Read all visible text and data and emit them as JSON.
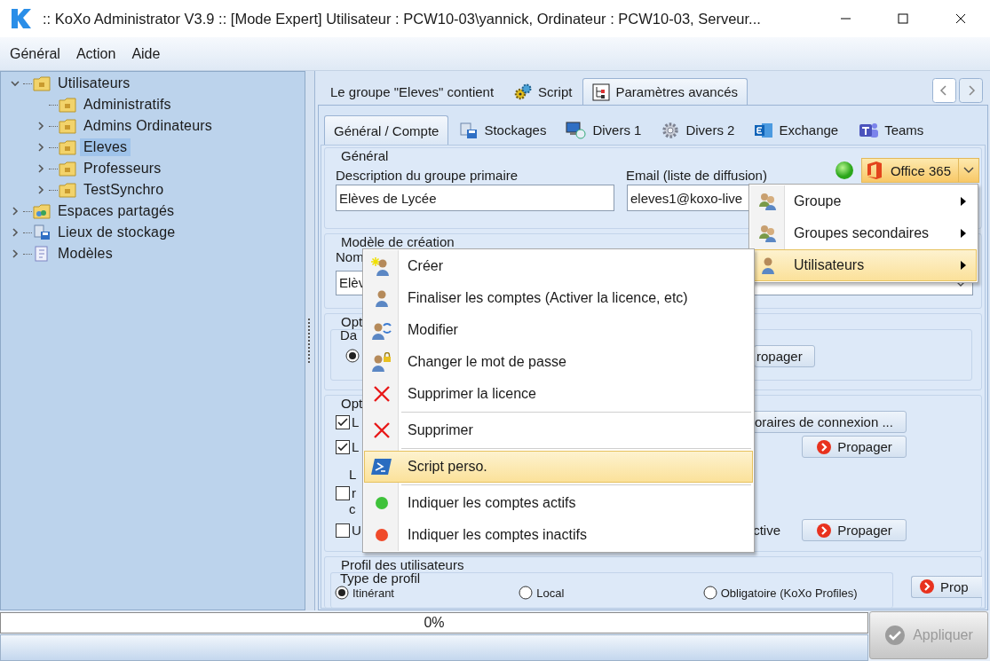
{
  "window": {
    "title": ":: KoXo Administrator V3.9 :: [Mode Expert] Utilisateur : PCW10-03\\yannick, Ordinateur : PCW10-03, Serveur..."
  },
  "menubar": [
    "Général",
    "Action",
    "Aide"
  ],
  "tree": [
    {
      "label": "Utilisateurs",
      "expandable": true,
      "expanded": true,
      "selected": false,
      "children": [
        {
          "label": "Administratifs",
          "expandable": false,
          "expanded": false,
          "selected": false
        },
        {
          "label": "Admins Ordinateurs",
          "expandable": true,
          "expanded": false,
          "selected": false
        },
        {
          "label": "Eleves",
          "expandable": true,
          "expanded": false,
          "selected": true
        },
        {
          "label": "Professeurs",
          "expandable": true,
          "expanded": false,
          "selected": false
        },
        {
          "label": "TestSynchro",
          "expandable": true,
          "expanded": false,
          "selected": false
        }
      ]
    },
    {
      "label": "Espaces partagés",
      "expandable": true,
      "expanded": false,
      "selected": false
    },
    {
      "label": "Lieux de stockage",
      "expandable": true,
      "expanded": false,
      "selected": false
    },
    {
      "label": "Modèles",
      "expandable": true,
      "expanded": false,
      "selected": false
    }
  ],
  "outer_tabs": [
    {
      "label": "Le groupe \"Eleves\" contient",
      "selected": false
    },
    {
      "label": "Script",
      "selected": false
    },
    {
      "label": "Paramètres avancés",
      "selected": true
    }
  ],
  "inner_tabs": [
    {
      "label": "Général / Compte",
      "selected": true
    },
    {
      "label": "Stockages",
      "selected": false
    },
    {
      "label": "Divers 1",
      "selected": false
    },
    {
      "label": "Divers 2",
      "selected": false
    },
    {
      "label": "Exchange",
      "selected": false
    },
    {
      "label": "Teams",
      "selected": false
    }
  ],
  "general_group": {
    "title": "Général",
    "description_label": "Description du groupe primaire",
    "description_value": "Elèves de Lycée",
    "email_label": "Email (liste de diffusion)",
    "email_value": "eleves1@koxo-live",
    "status_on": true,
    "office_button": "Office 365"
  },
  "creation_group": {
    "title": "Modèle de création",
    "name_label": "Nom",
    "template_value": "Elèv"
  },
  "options_group_1": {
    "title": "Opt",
    "subgroup_title": "Da",
    "radio_selected": true,
    "action": {
      "label": "ropager"
    }
  },
  "options_group_2": {
    "title": "Opt",
    "rows": [
      {
        "kind": "checkbox",
        "checked": true,
        "label": "L",
        "action": {
          "label": "oraires de connexion ..."
        }
      },
      {
        "kind": "checkbox",
        "checked": true,
        "label": "L",
        "action": {
          "label": "Propager",
          "kind": "propagate"
        }
      },
      {
        "kind": "text",
        "label": "L"
      },
      {
        "kind": "checkbox",
        "checked": false,
        "label": "r"
      },
      {
        "kind": "text",
        "label": "c"
      },
      {
        "kind": "checkbox",
        "checked": false,
        "label": "U",
        "note": "ctive",
        "action": {
          "label": "Propager",
          "kind": "propagate"
        }
      }
    ]
  },
  "profile_group": {
    "title": "Profil des utilisateurs",
    "subgroup_title": "Type de profil",
    "options": [
      {
        "label": "Itinérant",
        "selected": true
      },
      {
        "label": "Local",
        "selected": false
      },
      {
        "label": "Obligatoire (KoXo Profiles)",
        "selected": false
      }
    ],
    "action": {
      "label": "Prop",
      "kind": "propagate"
    }
  },
  "office_menu": {
    "items": [
      {
        "label": "Groupe",
        "selected": false,
        "submenu": true
      },
      {
        "label": "Groupes secondaires",
        "selected": false,
        "submenu": true
      },
      {
        "label": "Utilisateurs",
        "selected": true,
        "submenu": true
      }
    ]
  },
  "users_menu": {
    "items": [
      {
        "kind": "item",
        "label": "Créer",
        "selected": false
      },
      {
        "kind": "item",
        "label": "Finaliser les comptes (Activer la licence, etc)",
        "selected": false
      },
      {
        "kind": "item",
        "label": "Modifier",
        "selected": false
      },
      {
        "kind": "item",
        "label": "Changer le mot de passe",
        "selected": false
      },
      {
        "kind": "item",
        "label": "Supprimer la licence",
        "selected": false
      },
      {
        "kind": "separator"
      },
      {
        "kind": "item",
        "label": "Supprimer",
        "selected": false
      },
      {
        "kind": "separator"
      },
      {
        "kind": "item",
        "label": "Script perso.",
        "selected": true
      },
      {
        "kind": "separator"
      },
      {
        "kind": "item",
        "label": "Indiquer les comptes actifs",
        "selected": false
      },
      {
        "kind": "item",
        "label": "Indiquer les comptes inactifs",
        "selected": false
      }
    ]
  },
  "progress": {
    "level": 0,
    "text": "0%"
  },
  "apply_button": {
    "label": "Appliquer",
    "disabled": true
  }
}
